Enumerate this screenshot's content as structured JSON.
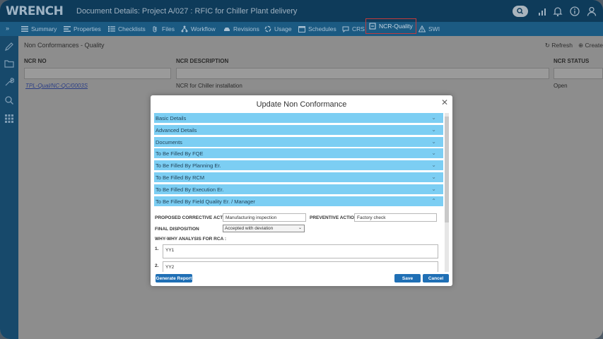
{
  "app": {
    "logo": "WRENCH",
    "doc_title": "Document Details: Project A/027 : RFIC for Chiller Plant delivery"
  },
  "tabs": [
    {
      "label": "Summary",
      "icon": "list-icon"
    },
    {
      "label": "Properties",
      "icon": "properties-icon"
    },
    {
      "label": "Checklists",
      "icon": "checklist-icon"
    },
    {
      "label": "Files",
      "icon": "paperclip-icon"
    },
    {
      "label": "Workflow",
      "icon": "workflow-icon"
    },
    {
      "label": "Revisions",
      "icon": "revisions-icon"
    },
    {
      "label": "Usage",
      "icon": "usage-icon"
    },
    {
      "label": "Schedules",
      "icon": "calendar-icon"
    },
    {
      "label": "CRS",
      "icon": "chat-icon"
    },
    {
      "label": "NCR-Quality",
      "icon": "ncr-icon",
      "active": true
    },
    {
      "label": "SWI",
      "icon": "warning-icon"
    }
  ],
  "page": {
    "title": "Non Conformances - Quality",
    "refresh": "Refresh",
    "create": "Create",
    "columns": [
      "NCR NO",
      "NCR DESCRIPTION",
      "NCR STATUS"
    ],
    "row": {
      "ncr_no": "TPL-Qual/NC-QC/0003S",
      "description": "NCR for Chiller installation",
      "status": "Open"
    }
  },
  "modal": {
    "title": "Update Non Conformance",
    "sections": [
      "Basic Details",
      "Advanced Details",
      "Documents",
      "To Be Filled By FQE",
      "To Be Filled By Planning Er.",
      "To Be Filled By RCM",
      "To Be Filled By Execution Er.",
      "To Be Filled By Field Quality Er. / Manager"
    ],
    "form": {
      "proposed_label": "PROPOSED CORRECTIVE ACTION",
      "proposed_value": "Manufacturing inspection",
      "preventive_label": "PREVENTIVE ACTION",
      "preventive_value": "Factory check",
      "final_label": "FINAL DISPOSITION",
      "final_value": "Accepted with deviation",
      "why_label": "WHY-WHY ANALYSIS FOR RCA :",
      "why1_num": "1.",
      "why1_value": "YY1",
      "why2_num": "2.",
      "why2_value": "YY2"
    },
    "buttons": {
      "generate": "Generate Report",
      "save": "Save",
      "cancel": "Cancel"
    }
  },
  "colors": {
    "header": "#0e3b5a",
    "tabbar": "#1b5a82",
    "accordion": "#7ccef3",
    "button": "#1f6fb5",
    "active_tab_border": "#c23b3b"
  }
}
